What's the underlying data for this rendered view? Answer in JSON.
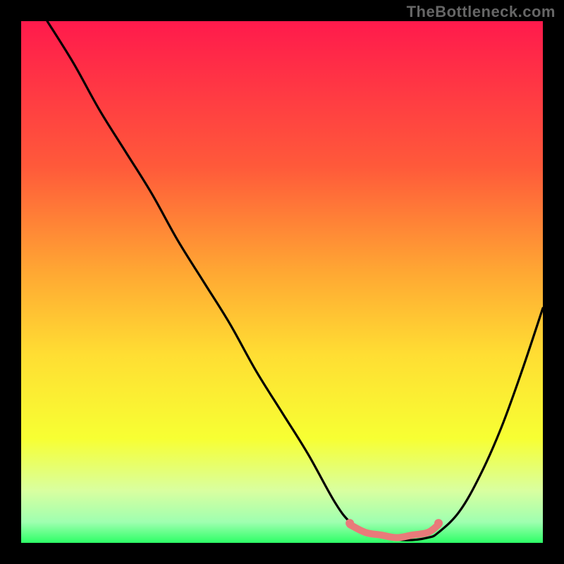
{
  "watermark": "TheBottleneck.com",
  "chart_data": {
    "type": "line",
    "title": "",
    "xlabel": "",
    "ylabel": "",
    "xlim": [
      0,
      100
    ],
    "ylim": [
      0,
      100
    ],
    "grid": false,
    "legend": false,
    "background": {
      "type": "vertical-gradient",
      "stops": [
        {
          "offset": 0.0,
          "color": "#ff1a4c"
        },
        {
          "offset": 0.28,
          "color": "#ff5a3a"
        },
        {
          "offset": 0.48,
          "color": "#ffa733"
        },
        {
          "offset": 0.64,
          "color": "#ffde33"
        },
        {
          "offset": 0.8,
          "color": "#f7ff33"
        },
        {
          "offset": 0.9,
          "color": "#d9ffa0"
        },
        {
          "offset": 0.96,
          "color": "#9fffb0"
        },
        {
          "offset": 1.0,
          "color": "#2dff66"
        }
      ]
    },
    "series": [
      {
        "name": "bottleneck-curve",
        "color": "#000000",
        "x": [
          5,
          10,
          15,
          20,
          25,
          30,
          35,
          40,
          45,
          50,
          55,
          60,
          63,
          66,
          70,
          74,
          78,
          80,
          84,
          88,
          92,
          96,
          100
        ],
        "y": [
          100,
          92,
          83,
          75,
          67,
          58,
          50,
          42,
          33,
          25,
          17,
          8,
          4,
          2,
          1,
          0.5,
          1,
          2,
          6,
          13,
          22,
          33,
          45
        ]
      }
    ],
    "markers": [
      {
        "name": "plateau-band",
        "color": "#e97a7a",
        "x": [
          63,
          66,
          69,
          72,
          75,
          78,
          80
        ],
        "y": [
          3.5,
          2,
          1.5,
          1,
          1.5,
          2,
          3.5
        ]
      }
    ]
  }
}
